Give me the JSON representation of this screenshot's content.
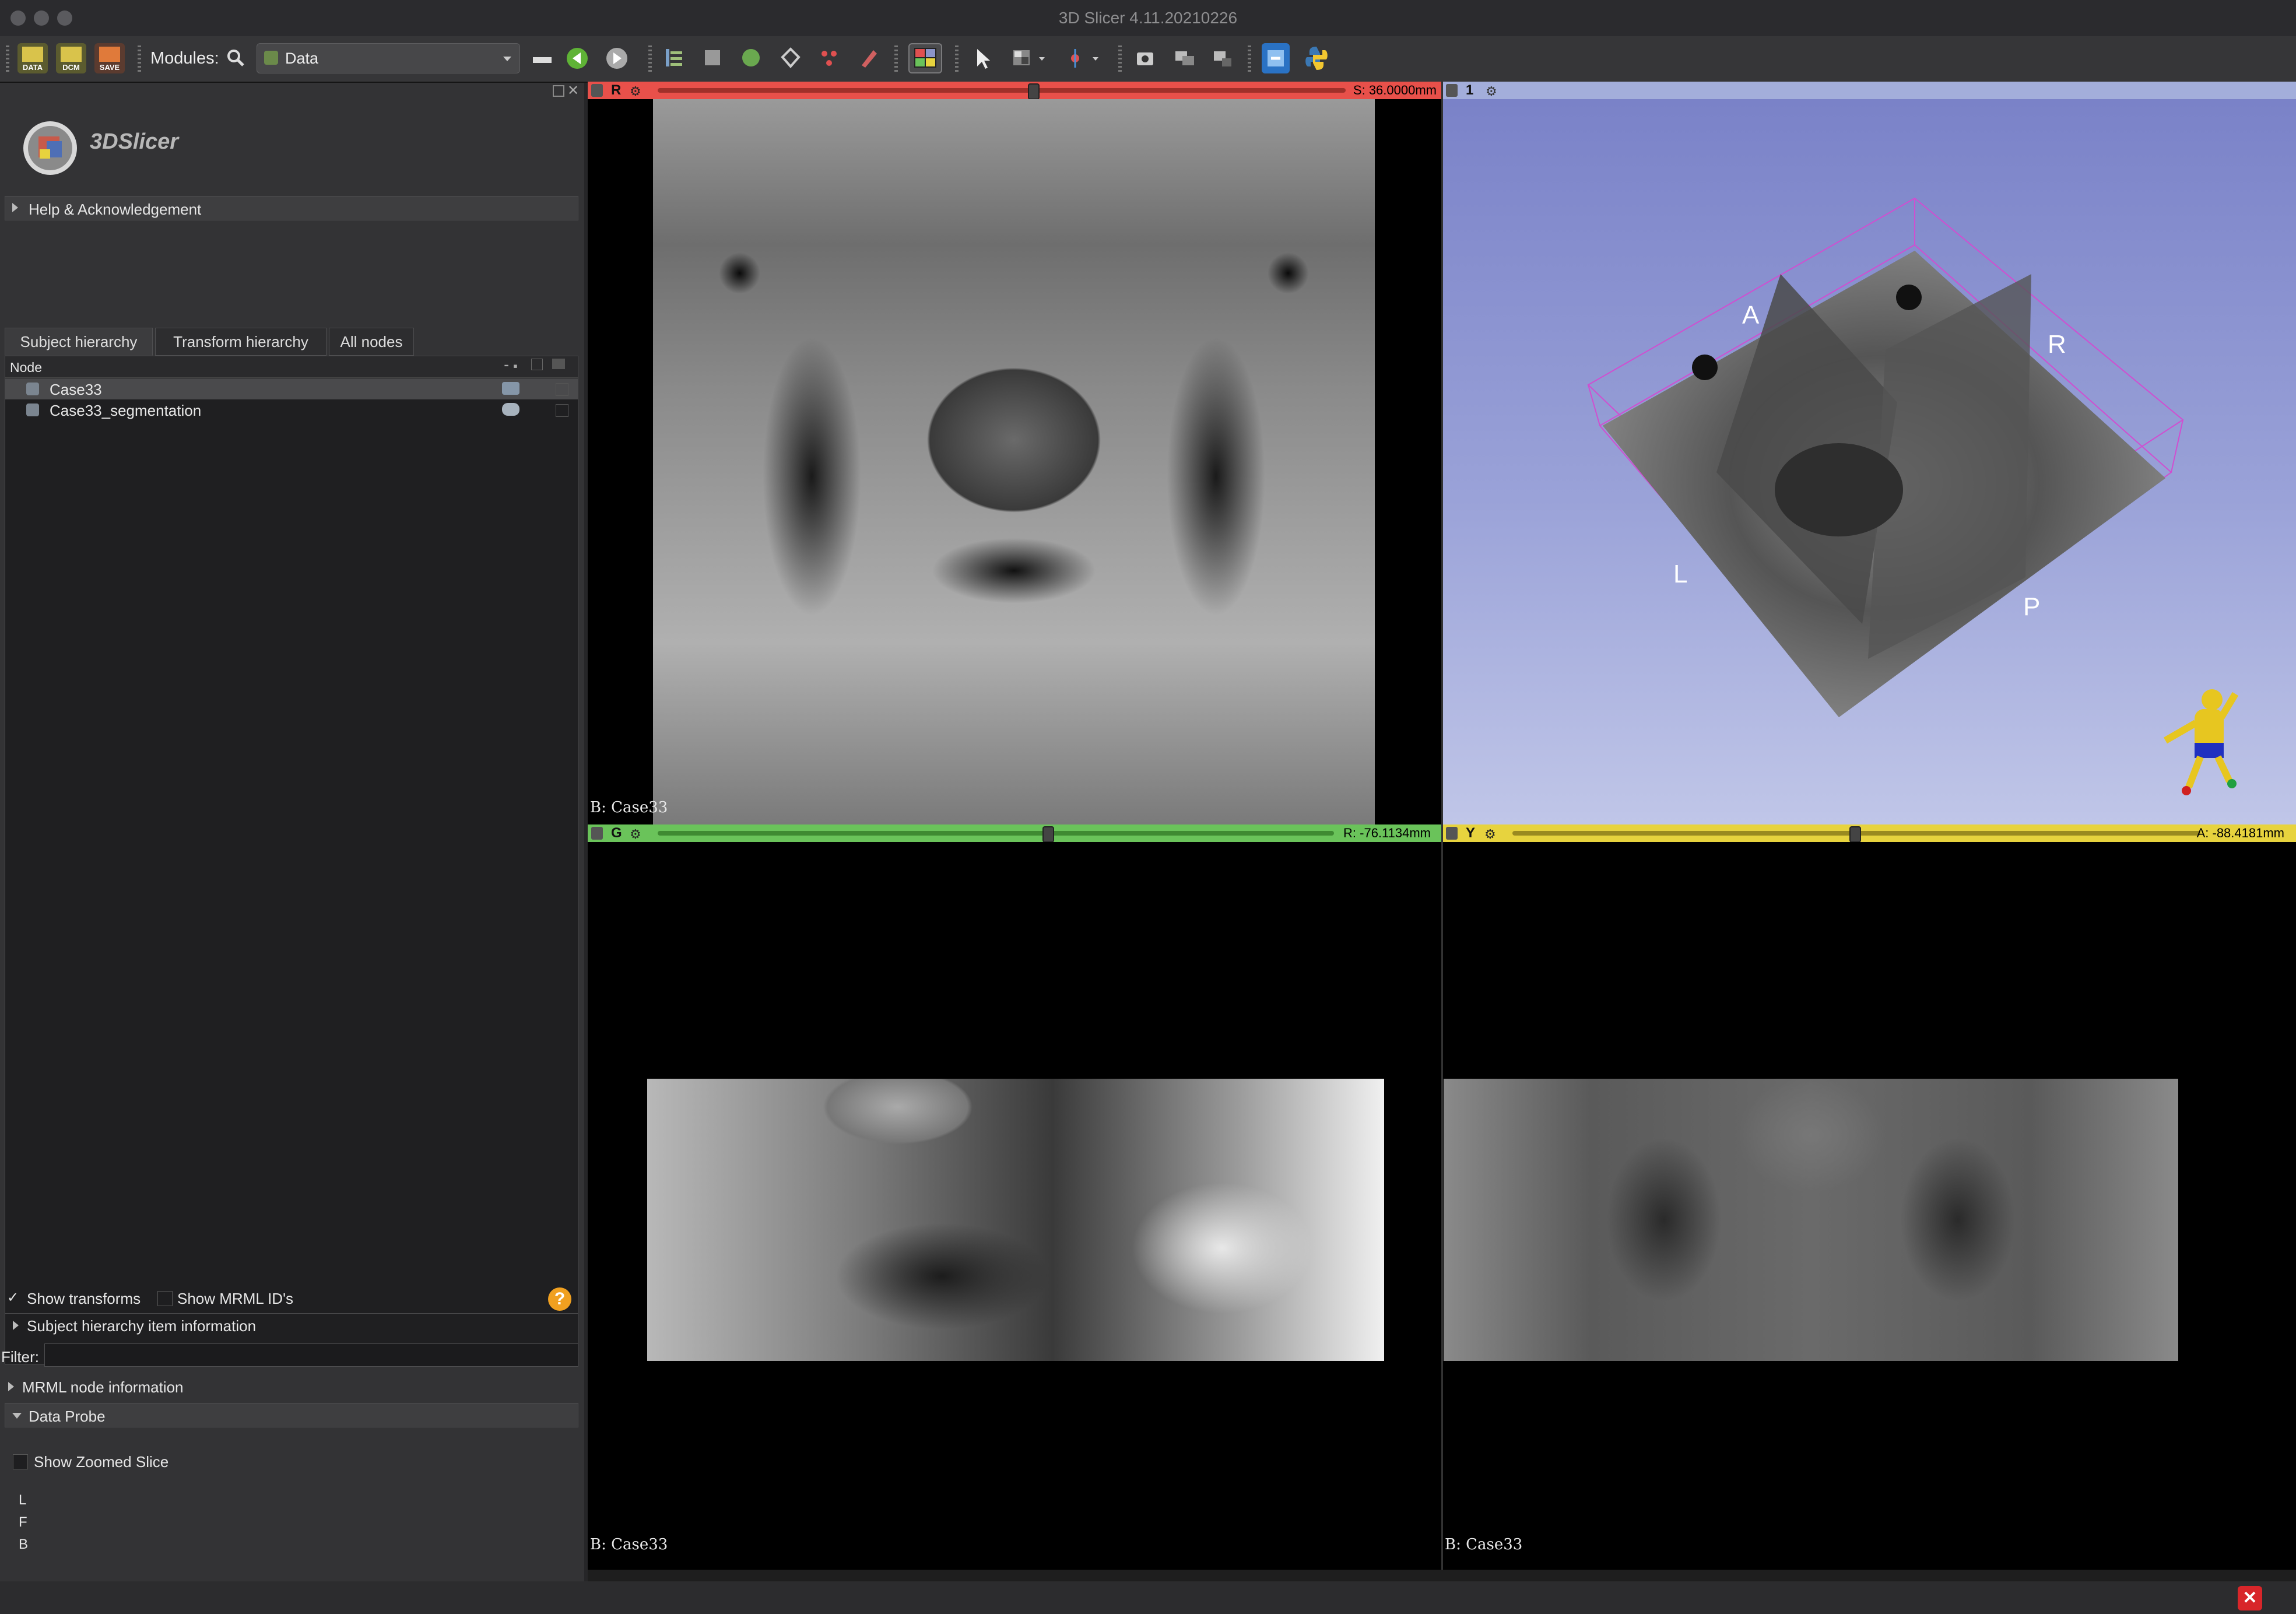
{
  "window": {
    "title": "3D Slicer 4.11.20210226"
  },
  "toolbar": {
    "modules_label": "Modules:",
    "module_selected": "Data",
    "icons": [
      "data-icon",
      "dcm-icon",
      "save-icon",
      "search-icon",
      "layout-icon",
      "back-icon",
      "forward-icon",
      "mouse-mode-icon",
      "window-level-icon",
      "python-icon"
    ],
    "icon_labels": {
      "data": "DATA",
      "dcm": "DCM",
      "save": "SAVE"
    }
  },
  "left_panel": {
    "logo_text": "3DSlicer",
    "help_header": "Help & Acknowledgement",
    "tabs": [
      "Subject hierarchy",
      "Transform hierarchy",
      "All nodes"
    ],
    "tree_header": "Node",
    "nodes": [
      {
        "label": "Case33",
        "selected": true
      },
      {
        "label": "Case33_segmentation",
        "selected": false
      }
    ],
    "show_transforms": "Show transforms",
    "show_mrml_ids": "Show MRML ID's",
    "item_info": "Subject hierarchy item information",
    "filter_label": "Filter:",
    "filter_value": "",
    "mrml_info": "MRML node information",
    "data_probe": "Data Probe",
    "show_zoomed": "Show Zoomed Slice",
    "probe_lines": [
      "L",
      "F",
      "B"
    ]
  },
  "views": {
    "red": {
      "label": "R",
      "offset": "S: 36.0000mm",
      "bg_label": "B: Case33",
      "color": "#e8504a"
    },
    "threed": {
      "label": "1",
      "orientation": {
        "A": "A",
        "R": "R",
        "L": "L",
        "P": "P"
      },
      "color": "#a3aedb"
    },
    "green": {
      "label": "G",
      "offset": "R: -76.1134mm",
      "bg_label": "B: Case33",
      "color": "#6ac35a"
    },
    "yellow": {
      "label": "Y",
      "offset": "A: -88.4181mm",
      "bg_label": "B: Case33",
      "color": "#e7d33e"
    }
  },
  "status": {
    "error_icon": "error-close-icon"
  }
}
